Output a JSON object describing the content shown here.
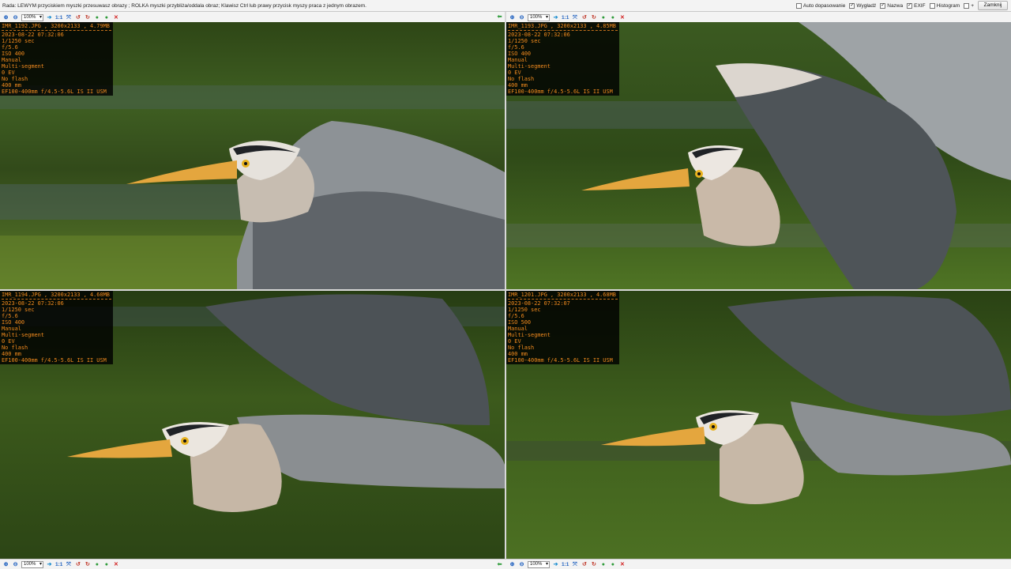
{
  "top_bar": {
    "hint": "Rada: LEWYM przyciskiem myszki przesuwasz obrazy ; ROLKA myszki przybliża/oddala obraz; Klawisz Ctrl lub prawy przycisk myszy praca z jednym obrazem.",
    "options": [
      {
        "label": "Auto dopasowanie",
        "checked": false
      },
      {
        "label": "Wygładź",
        "checked": true
      },
      {
        "label": "Nazwa",
        "checked": true
      },
      {
        "label": "EXIF",
        "checked": true
      },
      {
        "label": "Histogram",
        "checked": false
      },
      {
        "label": "+",
        "checked": false
      }
    ],
    "close_label": "Zamknij"
  },
  "toolbar": {
    "zoom_value": "100%",
    "one_to_one": "1:1",
    "icons": [
      "zoom-in-icon",
      "arrow-right-icon",
      "fit-icon",
      "rotate-left-icon",
      "rotate-right-icon",
      "arrow-next-icon",
      "delete-icon"
    ],
    "back_icon": "arrow-back-icon"
  },
  "panels": [
    {
      "id": "tl",
      "file": "IMR_1192.JPG , 3200x2133 , 4.79MB",
      "exif": [
        "2023-08-22 07:32:06",
        "1/1250 sec",
        "f/5.6",
        "ISO 400",
        "Manual",
        "Multi-segment",
        "0 EV",
        "No flash",
        "400 mm",
        "EF100-400mm f/4.5-5.6L IS II USM"
      ]
    },
    {
      "id": "tr",
      "file": "IMR_1193.JPG , 3200x2133 , 4.85MB",
      "exif": [
        "2023-08-22 07:32:06",
        "1/1250 sec",
        "f/5.6",
        "ISO 400",
        "Manual",
        "Multi-segment",
        "0 EV",
        "No flash",
        "400 mm",
        "EF100-400mm f/4.5-5.6L IS II USM"
      ]
    },
    {
      "id": "bl",
      "file": "IMR_1194.JPG , 3200x2133 , 4.60MB",
      "exif": [
        "2023-08-22 07:32:06",
        "1/1250 sec",
        "f/5.6",
        "ISO 400",
        "Manual",
        "Multi-segment",
        "0 EV",
        "No flash",
        "400 mm",
        "EF100-400mm f/4.5-5.6L IS II USM"
      ]
    },
    {
      "id": "br",
      "file": "IMR_1201.JPG , 3200x2133 , 4.68MB",
      "exif": [
        "2023-08-22 07:32:07",
        "1/1250 sec",
        "f/5.6",
        "ISO 500",
        "Manual",
        "Multi-segment",
        "0 EV",
        "No flash",
        "400 mm",
        "EF100-400mm f/4.5-5.6L IS II USM"
      ]
    }
  ],
  "colors": {
    "exif_text": "#f08a1e",
    "exif_bg": "#000000",
    "water_green": "#3b5a1c",
    "heron_grey": "#8c8f93",
    "beak_orange": "#e8a23a"
  }
}
